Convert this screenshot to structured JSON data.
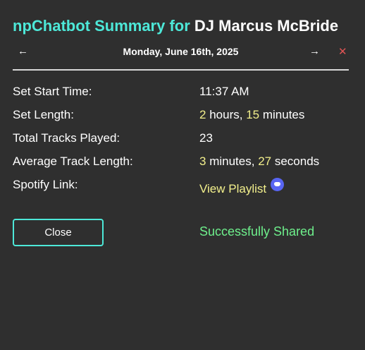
{
  "header": {
    "title_prefix": "npChatbot Summary for",
    "dj_name": "DJ Marcus McBride"
  },
  "nav": {
    "prev_icon": "←",
    "date": "Monday, June 16th, 2025",
    "next_icon": "→",
    "close_icon": "✕"
  },
  "summary": {
    "start_time": {
      "label": "Set Start Time:",
      "value": "11:37 AM"
    },
    "set_length": {
      "label": "Set Length:",
      "hours": "2",
      "hours_unit": "hours,",
      "minutes": "15",
      "minutes_unit": "minutes"
    },
    "tracks_played": {
      "label": "Total Tracks Played:",
      "value": "23"
    },
    "avg_track_length": {
      "label": "Average Track Length:",
      "minutes": "3",
      "minutes_unit": "minutes,",
      "seconds": "27",
      "seconds_unit": "seconds"
    },
    "spotify": {
      "label": "Spotify Link:",
      "link_text": "View Playlist",
      "icon": "discord-icon"
    }
  },
  "footer": {
    "close_label": "Close",
    "status": "Successfully Shared"
  },
  "colors": {
    "background": "#2f2f2f",
    "accent": "#4de8d8",
    "highlight": "#f3f08c",
    "success": "#6ef08c",
    "danger": "#e05555",
    "discord": "#5865f2"
  }
}
